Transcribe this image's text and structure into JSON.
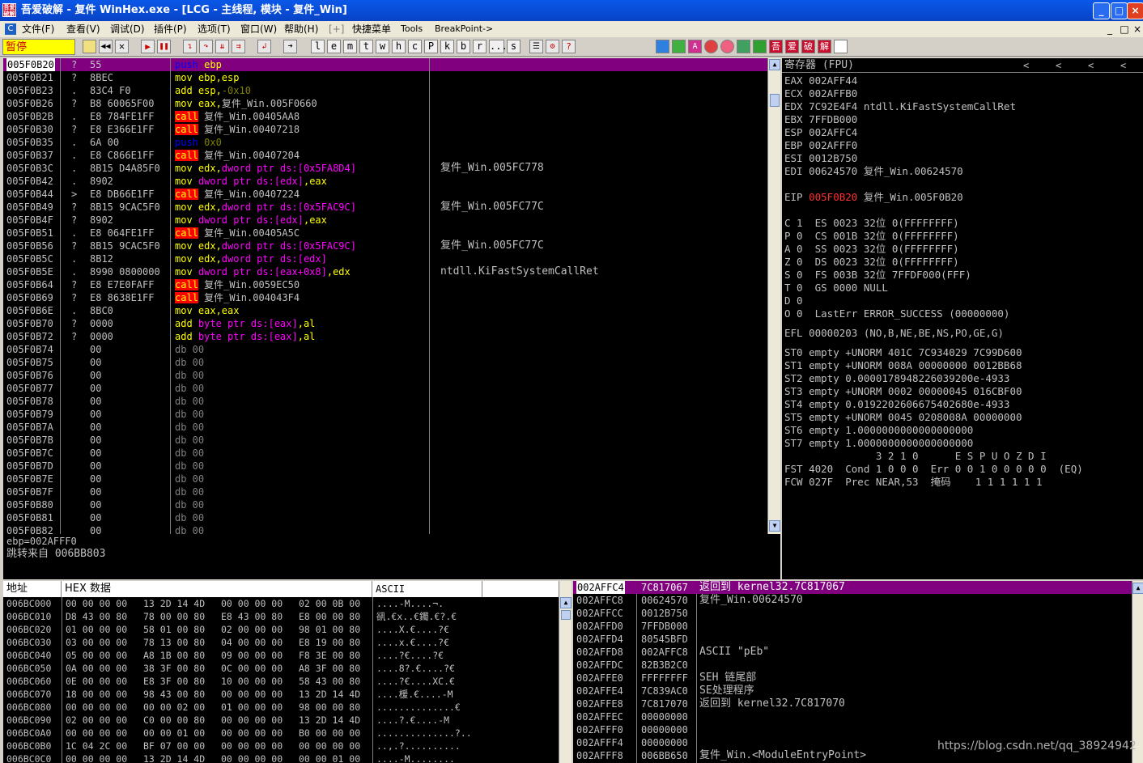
{
  "title": "吾爱破解 - 复件 WinHex.exe - [LCG -  主线程, 模块 - 复件_Win]",
  "app_icon_text": "吾爱破解",
  "window_buttons": [
    "_",
    "□",
    "×"
  ],
  "menu": [
    "C",
    "文件(F)",
    "查看(V)",
    "调试(D)",
    "插件(P)",
    "选项(T)",
    "窗口(W)",
    "帮助(H)",
    "[+]",
    "快捷菜单",
    "Tools",
    "BreakPoint->"
  ],
  "mdi_buttons": [
    "_",
    "□",
    "×"
  ],
  "status": "暂停",
  "toolbar_letters": [
    "l",
    "e",
    "m",
    "t",
    "w",
    "h",
    "c",
    "P",
    "k",
    "b",
    "r",
    "...",
    "s"
  ],
  "toolbar_right": [
    "吾",
    "爱",
    "破",
    "解"
  ],
  "disasm": {
    "rows": [
      {
        "addr": "005F0B20",
        "m": "?",
        "hex": "55",
        "ins": [
          [
            "push",
            "kw-push"
          ],
          [
            " ebp",
            "c-reg"
          ]
        ],
        "cmt": ""
      },
      {
        "addr": "005F0B21",
        "m": "?",
        "hex": "8BEC",
        "ins": [
          [
            "mov",
            "kw-mov"
          ],
          [
            " ebp,esp",
            "c-reg"
          ]
        ],
        "cmt": ""
      },
      {
        "addr": "005F0B23",
        "m": ".",
        "hex": "83C4 F0",
        "ins": [
          [
            "add",
            "kw-mov"
          ],
          [
            " esp,",
            "c-reg"
          ],
          [
            "-0x10",
            "c-num"
          ]
        ],
        "cmt": ""
      },
      {
        "addr": "005F0B26",
        "m": "?",
        "hex": "B8 60065F00",
        "ins": [
          [
            "mov",
            "kw-mov"
          ],
          [
            " eax,",
            "c-reg"
          ],
          [
            "复件_Win.005F0660",
            ""
          ]
        ],
        "cmt": ""
      },
      {
        "addr": "005F0B2B",
        "m": ".",
        "hex": "E8 784FE1FF",
        "ins": [
          [
            "call",
            "kw-call"
          ],
          [
            " 复件_Win.00405AA8",
            ""
          ]
        ],
        "cmt": ""
      },
      {
        "addr": "005F0B30",
        "m": "?",
        "hex": "E8 E366E1FF",
        "ins": [
          [
            "call",
            "kw-call"
          ],
          [
            " 复件_Win.00407218",
            ""
          ]
        ],
        "cmt": ""
      },
      {
        "addr": "005F0B35",
        "m": ".",
        "hex": "6A 00",
        "ins": [
          [
            "push",
            "kw-push"
          ],
          [
            " 0x0",
            "c-num"
          ]
        ],
        "cmt": ""
      },
      {
        "addr": "005F0B37",
        "m": ".",
        "hex": "E8 C866E1FF",
        "ins": [
          [
            "call",
            "kw-call"
          ],
          [
            " 复件_Win.00407204",
            ""
          ]
        ],
        "cmt": ""
      },
      {
        "addr": "005F0B3C",
        "m": ".",
        "hex": "8B15 D4A85F0",
        "ins": [
          [
            "mov",
            "kw-mov"
          ],
          [
            " edx,",
            "c-reg"
          ],
          [
            "dword ptr ds:[0x5FA8D4]",
            "c-mem"
          ]
        ],
        "cmt": "复件_Win.005FC778"
      },
      {
        "addr": "005F0B42",
        "m": ".",
        "hex": "8902",
        "ins": [
          [
            "mov",
            "kw-mov"
          ],
          [
            " dword ptr ds:[edx]",
            "c-mem"
          ],
          [
            ",eax",
            "c-reg"
          ]
        ],
        "cmt": ""
      },
      {
        "addr": "005F0B44",
        "m": ">",
        "hex": "E8 DB66E1FF",
        "ins": [
          [
            "call",
            "kw-call"
          ],
          [
            " 复件_Win.00407224",
            ""
          ]
        ],
        "cmt": ""
      },
      {
        "addr": "005F0B49",
        "m": "?",
        "hex": "8B15 9CAC5F0",
        "ins": [
          [
            "mov",
            "kw-mov"
          ],
          [
            " edx,",
            "c-reg"
          ],
          [
            "dword ptr ds:[0x5FAC9C]",
            "c-mem"
          ]
        ],
        "cmt": "复件_Win.005FC77C"
      },
      {
        "addr": "005F0B4F",
        "m": "?",
        "hex": "8902",
        "ins": [
          [
            "mov",
            "kw-mov"
          ],
          [
            " dword ptr ds:[edx]",
            "c-mem"
          ],
          [
            ",eax",
            "c-reg"
          ]
        ],
        "cmt": ""
      },
      {
        "addr": "005F0B51",
        "m": ".",
        "hex": "E8 064FE1FF",
        "ins": [
          [
            "call",
            "kw-call"
          ],
          [
            " 复件_Win.00405A5C",
            ""
          ]
        ],
        "cmt": ""
      },
      {
        "addr": "005F0B56",
        "m": "?",
        "hex": "8B15 9CAC5F0",
        "ins": [
          [
            "mov",
            "kw-mov"
          ],
          [
            " edx,",
            "c-reg"
          ],
          [
            "dword ptr ds:[0x5FAC9C]",
            "c-mem"
          ]
        ],
        "cmt": "复件_Win.005FC77C"
      },
      {
        "addr": "005F0B5C",
        "m": ".",
        "hex": "8B12",
        "ins": [
          [
            "mov",
            "kw-mov"
          ],
          [
            " edx,",
            "c-reg"
          ],
          [
            "dword ptr ds:[edx]",
            "c-mem"
          ]
        ],
        "cmt": ""
      },
      {
        "addr": "005F0B5E",
        "m": ".",
        "hex": "8990 0800000",
        "ins": [
          [
            "mov",
            "kw-mov"
          ],
          [
            " dword ptr ds:[eax+0x8]",
            "c-mem"
          ],
          [
            ",edx",
            "c-reg"
          ]
        ],
        "cmt": "ntdll.KiFastSystemCallRet"
      },
      {
        "addr": "005F0B64",
        "m": "?",
        "hex": "E8 E7E0FAFF",
        "ins": [
          [
            "call",
            "kw-call"
          ],
          [
            " 复件_Win.0059EC50",
            ""
          ]
        ],
        "cmt": ""
      },
      {
        "addr": "005F0B69",
        "m": "?",
        "hex": "E8 8638E1FF",
        "ins": [
          [
            "call",
            "kw-call"
          ],
          [
            " 复件_Win.004043F4",
            ""
          ]
        ],
        "cmt": ""
      },
      {
        "addr": "005F0B6E",
        "m": ".",
        "hex": "8BC0",
        "ins": [
          [
            "mov",
            "kw-mov"
          ],
          [
            " eax,eax",
            "c-reg"
          ]
        ],
        "cmt": ""
      },
      {
        "addr": "005F0B70",
        "m": "?",
        "hex": "0000",
        "ins": [
          [
            "add",
            "kw-mov"
          ],
          [
            " byte ptr ds:[eax]",
            "c-mem"
          ],
          [
            ",al",
            "c-reg"
          ]
        ],
        "cmt": ""
      },
      {
        "addr": "005F0B72",
        "m": "?",
        "hex": "0000",
        "ins": [
          [
            "add",
            "kw-mov"
          ],
          [
            " byte ptr ds:[eax]",
            "c-mem"
          ],
          [
            ",al",
            "c-reg"
          ]
        ],
        "cmt": ""
      },
      {
        "addr": "005F0B74",
        "m": "",
        "hex": "00",
        "ins": [
          [
            "db 00",
            "c-db"
          ]
        ],
        "cmt": ""
      },
      {
        "addr": "005F0B75",
        "m": "",
        "hex": "00",
        "ins": [
          [
            "db 00",
            "c-db"
          ]
        ],
        "cmt": ""
      },
      {
        "addr": "005F0B76",
        "m": "",
        "hex": "00",
        "ins": [
          [
            "db 00",
            "c-db"
          ]
        ],
        "cmt": ""
      },
      {
        "addr": "005F0B77",
        "m": "",
        "hex": "00",
        "ins": [
          [
            "db 00",
            "c-db"
          ]
        ],
        "cmt": ""
      },
      {
        "addr": "005F0B78",
        "m": "",
        "hex": "00",
        "ins": [
          [
            "db 00",
            "c-db"
          ]
        ],
        "cmt": ""
      },
      {
        "addr": "005F0B79",
        "m": "",
        "hex": "00",
        "ins": [
          [
            "db 00",
            "c-db"
          ]
        ],
        "cmt": ""
      },
      {
        "addr": "005F0B7A",
        "m": "",
        "hex": "00",
        "ins": [
          [
            "db 00",
            "c-db"
          ]
        ],
        "cmt": ""
      },
      {
        "addr": "005F0B7B",
        "m": "",
        "hex": "00",
        "ins": [
          [
            "db 00",
            "c-db"
          ]
        ],
        "cmt": ""
      },
      {
        "addr": "005F0B7C",
        "m": "",
        "hex": "00",
        "ins": [
          [
            "db 00",
            "c-db"
          ]
        ],
        "cmt": ""
      },
      {
        "addr": "005F0B7D",
        "m": "",
        "hex": "00",
        "ins": [
          [
            "db 00",
            "c-db"
          ]
        ],
        "cmt": ""
      },
      {
        "addr": "005F0B7E",
        "m": "",
        "hex": "00",
        "ins": [
          [
            "db 00",
            "c-db"
          ]
        ],
        "cmt": ""
      },
      {
        "addr": "005F0B7F",
        "m": "",
        "hex": "00",
        "ins": [
          [
            "db 00",
            "c-db"
          ]
        ],
        "cmt": ""
      },
      {
        "addr": "005F0B80",
        "m": "",
        "hex": "00",
        "ins": [
          [
            "db 00",
            "c-db"
          ]
        ],
        "cmt": ""
      },
      {
        "addr": "005F0B81",
        "m": "",
        "hex": "00",
        "ins": [
          [
            "db 00",
            "c-db"
          ]
        ],
        "cmt": ""
      },
      {
        "addr": "005F0B82",
        "m": "",
        "hex": "00",
        "ins": [
          [
            "db 00",
            "c-db"
          ]
        ],
        "cmt": ""
      }
    ]
  },
  "info": [
    "ebp=002AFFF0",
    "跳转来自 006BB803"
  ],
  "registers": {
    "title": "寄存器 (FPU)",
    "nav": [
      "<",
      "<",
      "<",
      "<"
    ],
    "lines": [
      {
        "y": 0,
        "t": "EAX 002AFF44"
      },
      {
        "y": 1,
        "t": "ECX 002AFFB0"
      },
      {
        "y": 2,
        "t": "EDX 7C92E4F4 ntdll.KiFastSystemCallRet"
      },
      {
        "y": 3,
        "t": "EBX 7FFDB000"
      },
      {
        "y": 4,
        "t": "ESP 002AFFC4"
      },
      {
        "y": 5,
        "t": "EBP 002AFFF0"
      },
      {
        "y": 6,
        "t": "ESI 0012B750"
      },
      {
        "y": 7,
        "t": "EDI 00624570 复件_Win.00624570"
      },
      {
        "y": 9,
        "t": "EIP ",
        "red": "005F0B20",
        "rest": " 复件_Win.005F0B20"
      },
      {
        "y": 11,
        "t": "C 1  ES 0023 32位 0(FFFFFFFF)"
      },
      {
        "y": 12,
        "t": "P 0  CS 001B 32位 0(FFFFFFFF)"
      },
      {
        "y": 13,
        "t": "A 0  SS 0023 32位 0(FFFFFFFF)"
      },
      {
        "y": 14,
        "t": "Z 0  DS 0023 32位 0(FFFFFFFF)"
      },
      {
        "y": 15,
        "t": "S 0  FS 003B 32位 7FFDF000(FFF)"
      },
      {
        "y": 16,
        "t": "T 0  GS 0000 NULL"
      },
      {
        "y": 17,
        "t": "D 0"
      },
      {
        "y": 18,
        "t": "O 0  LastErr ERROR_SUCCESS (00000000)"
      },
      {
        "y": 19.5,
        "t": "EFL 00000203 (NO,B,NE,BE,NS,PO,GE,G)"
      },
      {
        "y": 21,
        "t": "ST0 empty +UNORM 401C 7C934029 7C99D600"
      },
      {
        "y": 22,
        "t": "ST1 empty +UNORM 008A 00000000 0012BB68"
      },
      {
        "y": 23,
        "t": "ST2 empty 0.0000178948226039200e-4933"
      },
      {
        "y": 24,
        "t": "ST3 empty +UNORM 0002 00000045 016CBF00"
      },
      {
        "y": 25,
        "t": "ST4 empty 0.0192202606675402680e-4933"
      },
      {
        "y": 26,
        "t": "ST5 empty +UNORM 0045 0208008A 00000000"
      },
      {
        "y": 27,
        "t": "ST6 empty 1.0000000000000000000"
      },
      {
        "y": 28,
        "t": "ST7 empty 1.0000000000000000000"
      },
      {
        "y": 29,
        "t": "               3 2 1 0      E S P U O Z D I"
      },
      {
        "y": 30,
        "t": "FST 4020  Cond 1 0 0 0  Err 0 0 1 0 0 0 0 0  (EQ)"
      },
      {
        "y": 31,
        "t": "FCW 027F  Prec NEAR,53  掩码    1 1 1 1 1 1"
      }
    ]
  },
  "dump": {
    "headers": [
      "地址",
      "HEX 数据",
      "ASCII"
    ],
    "rows": [
      {
        "a": "006BC000",
        "h": "00 00 00 00|13 2D 14 4D|00 00 00 00|02 00 0B 00",
        "s": "....-M....¬."
      },
      {
        "a": "006BC010",
        "h": "D8 43 00 80|78 00 00 80|E8 43 00 80|E8 00 00 80",
        "s": "谻.€x..€鐲.€?.€"
      },
      {
        "a": "006BC020",
        "h": "01 00 00 00|58 01 00 80|02 00 00 00|98 01 00 80",
        "s": "....X.€....?€"
      },
      {
        "a": "006BC030",
        "h": "03 00 00 00|78 13 00 80|04 00 00 00|E8 19 00 80",
        "s": "....x.€....?€"
      },
      {
        "a": "006BC040",
        "h": "05 00 00 00|A8 1B 00 80|09 00 00 00|F8 3E 00 80",
        "s": "....?€....?€"
      },
      {
        "a": "006BC050",
        "h": "0A 00 00 00|38 3F 00 80|0C 00 00 00|A8 3F 00 80",
        "s": "....8?.€....?€"
      },
      {
        "a": "006BC060",
        "h": "0E 00 00 00|E8 3F 00 80|10 00 00 00|58 43 00 80",
        "s": "....?€....XC.€"
      },
      {
        "a": "006BC070",
        "h": "18 00 00 00|98 43 00 80|00 00 00 00|13 2D 14 4D",
        "s": "....楥.€....-M"
      },
      {
        "a": "006BC080",
        "h": "00 00 00 00|00 00 02 00|01 00 00 00|98 00 00 80",
        "s": "..............€"
      },
      {
        "a": "006BC090",
        "h": "02 00 00 00|C0 00 00 80|00 00 00 00|13 2D 14 4D",
        "s": "....?.€....-M"
      },
      {
        "a": "006BC0A0",
        "h": "00 00 00 00|00 00 01 00|00 00 00 00|B0 00 00 00",
        "s": "..............?.."
      },
      {
        "a": "006BC0B0",
        "h": "1C 04 2C 00|BF 07 00 00|00 00 00 00|00 00 00 00",
        "s": "..,.?.........."
      },
      {
        "a": "006BC0C0",
        "h": "00 00 00 00|13 2D 14 4D|00 00 00 00|00 00 01 00",
        "s": "....-M........"
      }
    ]
  },
  "stack": {
    "rows": [
      {
        "a": "002AFFC4",
        "v": "7C817067",
        "c": "返回到 kernel32.7C817067",
        "sel": true
      },
      {
        "a": "002AFFC8",
        "v": "00624570",
        "c": "复件_Win.00624570"
      },
      {
        "a": "002AFFCC",
        "v": "0012B750",
        "c": ""
      },
      {
        "a": "002AFFD0",
        "v": "7FFDB000",
        "c": ""
      },
      {
        "a": "002AFFD4",
        "v": "80545BFD",
        "c": ""
      },
      {
        "a": "002AFFD8",
        "v": "002AFFC8",
        "c": "ASCII \"pEb\""
      },
      {
        "a": "002AFFDC",
        "v": "82B3B2C0",
        "c": ""
      },
      {
        "a": "002AFFE0",
        "v": "FFFFFFFF",
        "c": "SEH 链尾部"
      },
      {
        "a": "002AFFE4",
        "v": "7C839AC0",
        "c": "SE处理程序"
      },
      {
        "a": "002AFFE8",
        "v": "7C817070",
        "c": "返回到 kernel32.7C817070"
      },
      {
        "a": "002AFFEC",
        "v": "00000000",
        "c": ""
      },
      {
        "a": "002AFFF0",
        "v": "00000000",
        "c": ""
      },
      {
        "a": "002AFFF4",
        "v": "00000000",
        "c": ""
      },
      {
        "a": "002AFFF8",
        "v": "006BB650",
        "c": "复件_Win.<ModuleEntryPoint>"
      }
    ]
  },
  "watermark": "https://blog.csdn.net/qq_38924942"
}
